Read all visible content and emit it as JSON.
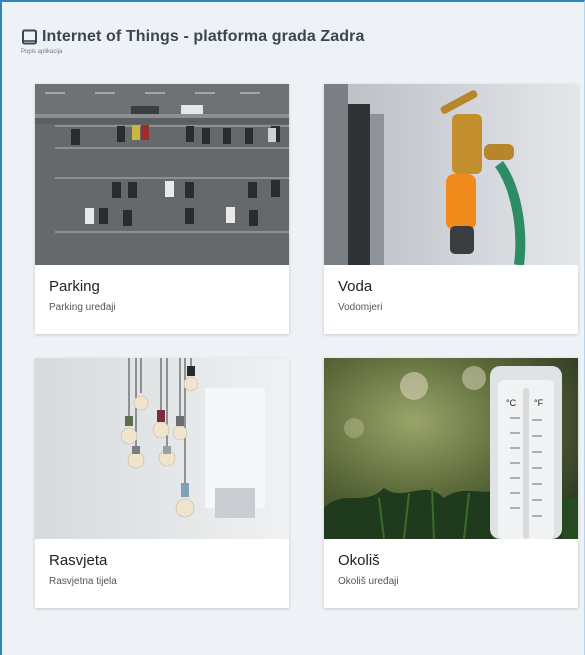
{
  "header": {
    "title": "Internet of Things - platforma grada Zadra",
    "subtitle": "Popis aplikacija",
    "icon": "tablet-icon"
  },
  "cards": [
    {
      "title": "Parking",
      "description": "Parking uređaji",
      "image": "parking-lot-photo"
    },
    {
      "title": "Voda",
      "description": "Vodomjeri",
      "image": "water-tap-photo"
    },
    {
      "title": "Rasvjeta",
      "description": "Rasvjetna tijela",
      "image": "light-bulbs-photo"
    },
    {
      "title": "Okoliš",
      "description": "Okoliš uređaji",
      "image": "thermometer-photo"
    }
  ],
  "colors": {
    "accent": "#2e86c1",
    "background": "#eef2f6",
    "title": "#3a4750"
  }
}
